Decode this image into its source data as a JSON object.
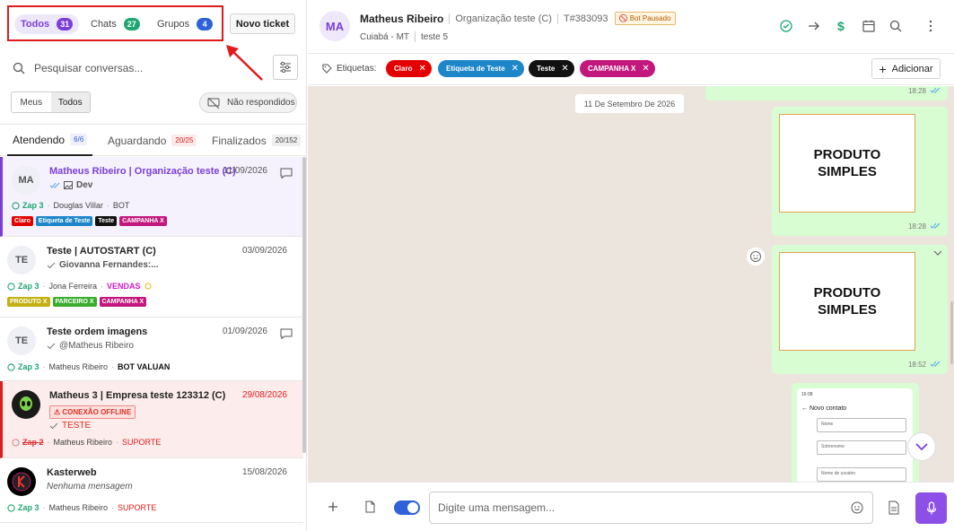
{
  "left": {
    "filters": [
      {
        "label": "Todos",
        "count": "31"
      },
      {
        "label": "Chats",
        "count": "27"
      },
      {
        "label": "Grupos",
        "count": "4"
      }
    ],
    "new_ticket_label": "Novo ticket",
    "search_placeholder": "Pesquisar conversas...",
    "scope": [
      "Meus",
      "Todos"
    ],
    "unanswered_label": "Não respondidos",
    "status_tabs": [
      {
        "label": "Atendendo",
        "count": "6/6"
      },
      {
        "label": "Aguardando",
        "count": "20/25"
      },
      {
        "label": "Finalizados",
        "count": "20/152"
      }
    ],
    "conversations": [
      {
        "avatar": "MA",
        "name": "Matheus Ribeiro | Organização teste (C)",
        "date": "11/09/2026",
        "preview": "Dev",
        "connection": "Zap 3",
        "agent": "Douglas Villar",
        "queue": "BOT",
        "tags": [
          {
            "label": "Claro",
            "color": "#e40000"
          },
          {
            "label": "Etiqueta de Teste",
            "color": "#1c86c9"
          },
          {
            "label": "Teste",
            "color": "#111111"
          },
          {
            "label": "CAMPANHA X",
            "color": "#c2187d"
          }
        ]
      },
      {
        "avatar": "TE",
        "name": "Teste | AUTOSTART (C)",
        "date": "03/09/2026",
        "preview": "Giovanna Fernandes:...",
        "connection": "Zap 3",
        "agent": "Jona Ferreira",
        "queue": "VENDAS",
        "queue_color": "#d21cc4",
        "tags": [
          {
            "label": "PRODUTO X",
            "color": "#c4b012"
          },
          {
            "label": "PARCEIRO X",
            "color": "#3aad2f"
          },
          {
            "label": "CAMPANHA X",
            "color": "#c2187d"
          }
        ]
      },
      {
        "avatar": "TE",
        "name": "Teste ordem imagens",
        "date": "01/09/2026",
        "preview": "@Matheus Ribeiro",
        "connection": "Zap 3",
        "agent": "Matheus Ribeiro",
        "queue": "BOT VALUAN"
      },
      {
        "name": "Matheus 3 | Empresa teste 123312 (C)",
        "date": "29/08/2026",
        "offline_label": "CONEXÃO OFFLINE",
        "preview": "TESTE",
        "connection": "Zap 2",
        "agent": "Matheus Ribeiro",
        "queue": "SUPORTE"
      },
      {
        "name": "Kasterweb",
        "date": "15/08/2026",
        "preview": "Nenhuma mensagem",
        "connection": "Zap 3",
        "agent": "Matheus Ribeiro",
        "queue": "SUPORTE"
      }
    ]
  },
  "header": {
    "avatar": "MA",
    "name": "Matheus Ribeiro",
    "org": "Organização teste (C)",
    "ticket": "T#383093",
    "bot_status": "Bot Pausado",
    "location": "Cuiabá - MT",
    "queue": "teste 5",
    "tags_label": "Etiquetas:",
    "tags": [
      {
        "label": "Claro",
        "color": "#e40000"
      },
      {
        "label": "Etiqueta de Teste",
        "color": "#1c86c9"
      },
      {
        "label": "Teste",
        "color": "#111111"
      },
      {
        "label": "CAMPANHA X",
        "color": "#c2187d"
      }
    ],
    "add_label": "Adicionar"
  },
  "chat": {
    "date_chip": "11 De Setembro De 2026",
    "messages": [
      {
        "time": "18:28"
      },
      {
        "product_line1": "PRODUTO",
        "product_line2": "SIMPLES",
        "time": "18:28"
      },
      {
        "product_line1": "PRODUTO",
        "product_line2": "SIMPLES",
        "time": "18:52"
      },
      {
        "phone_time": "16:08",
        "phone_title": "Novo contato",
        "fields": [
          "Nome",
          "Sobrenome",
          "Nome de usuário"
        ]
      }
    ]
  },
  "composer": {
    "placeholder": "Digite uma mensagem..."
  },
  "colors": {
    "accent": "#7b3fd9",
    "highlight_box": "#e01b1b",
    "bubble": "#d9fdd3",
    "chat_bg": "#ece5dd"
  }
}
